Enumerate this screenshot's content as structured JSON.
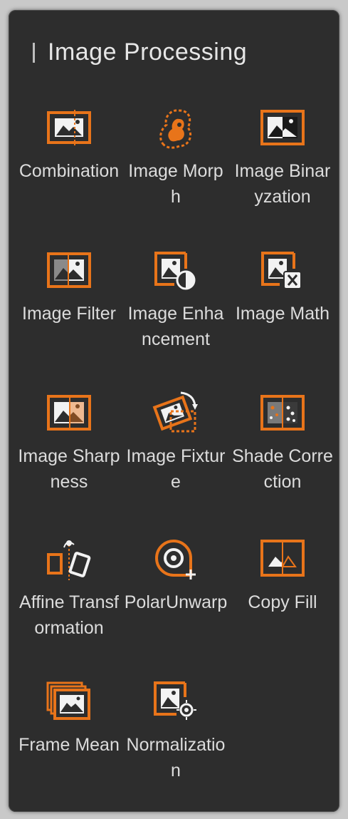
{
  "panel": {
    "title": "Image Processing",
    "accent_color": "#e8741a",
    "tools": [
      {
        "label": "Combination",
        "icon": "combination-icon"
      },
      {
        "label": "Image Morph",
        "icon": "morph-icon"
      },
      {
        "label": "Image Binaryzation",
        "icon": "binaryzation-icon"
      },
      {
        "label": "Image Filter",
        "icon": "filter-icon"
      },
      {
        "label": "Image Enhancement",
        "icon": "enhancement-icon"
      },
      {
        "label": "Image Math",
        "icon": "math-icon"
      },
      {
        "label": "Image Sharpness",
        "icon": "sharpness-icon"
      },
      {
        "label": "Image Fixture",
        "icon": "fixture-icon"
      },
      {
        "label": "Shade Correction",
        "icon": "shade-correction-icon"
      },
      {
        "label": "Affine Transformation",
        "icon": "affine-transform-icon"
      },
      {
        "label": "PolarUnwarp",
        "icon": "polar-unwarp-icon"
      },
      {
        "label": "Copy Fill",
        "icon": "copy-fill-icon"
      },
      {
        "label": "Frame Mean",
        "icon": "frame-mean-icon"
      },
      {
        "label": "Normalization",
        "icon": "normalization-icon"
      }
    ]
  }
}
